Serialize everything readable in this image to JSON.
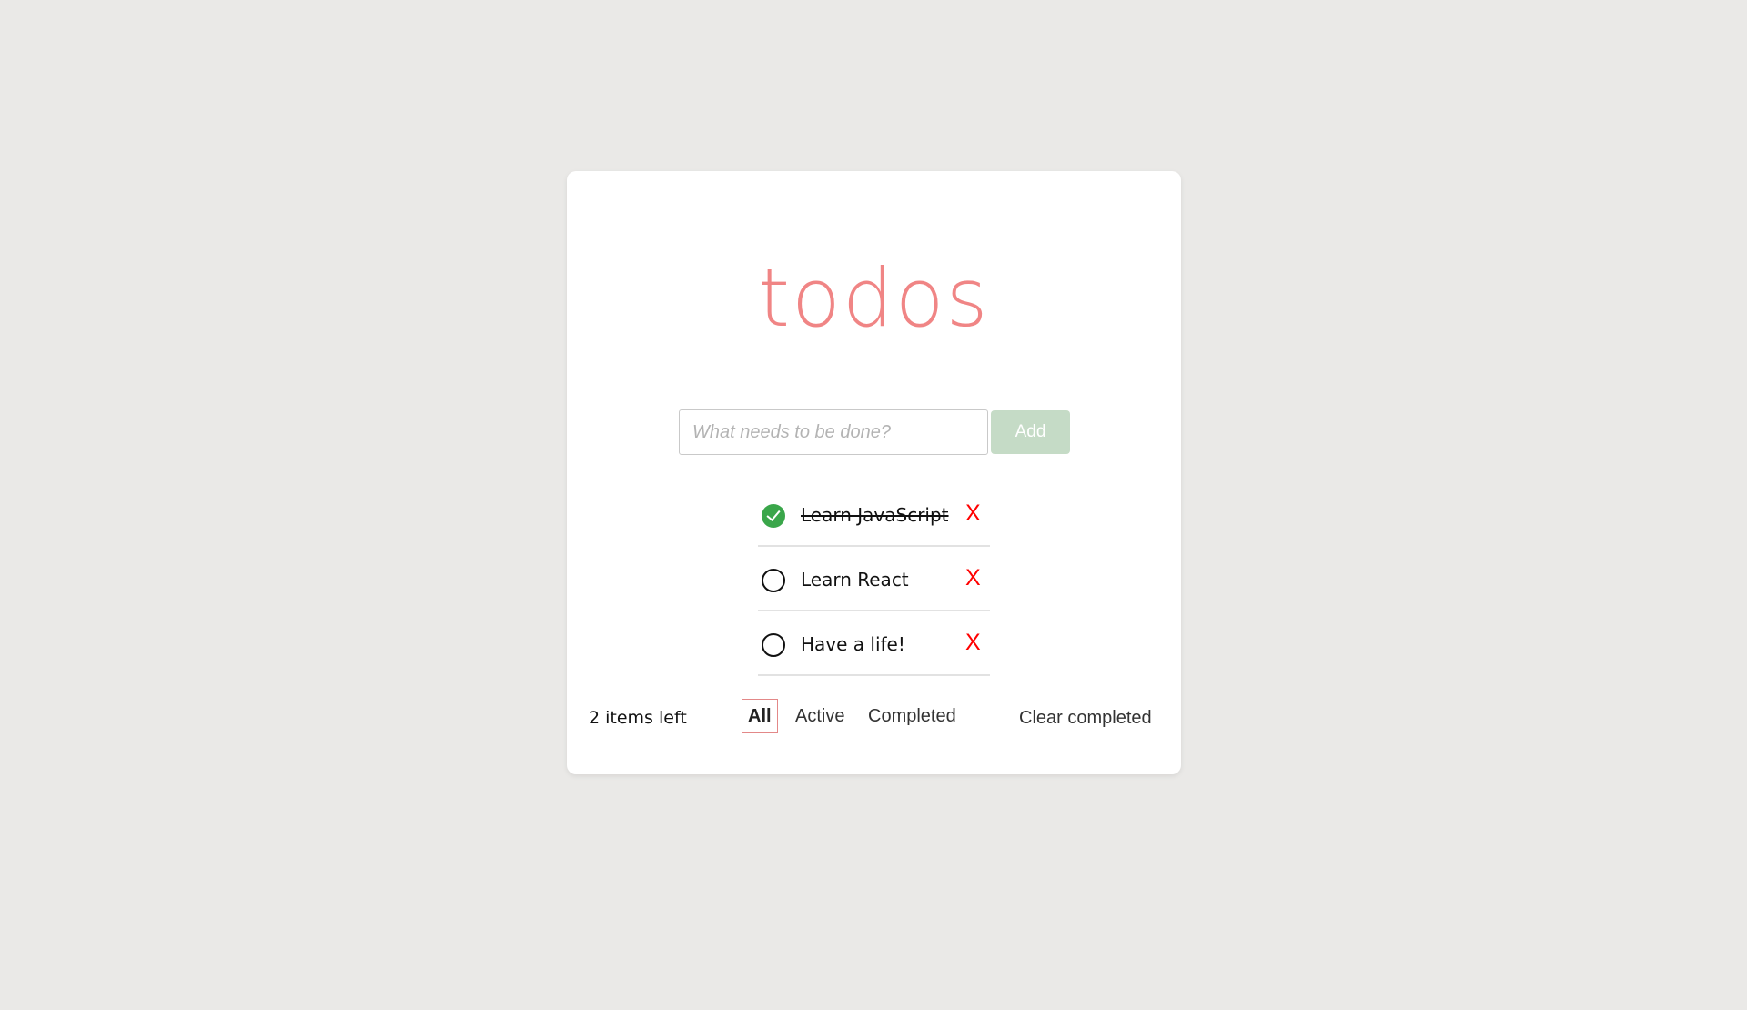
{
  "app": {
    "title": "todos"
  },
  "new_todo": {
    "placeholder": "What needs to be done?",
    "value": "",
    "add_label": "Add"
  },
  "todos": [
    {
      "text": "Learn JavaScript",
      "completed": true,
      "delete_label": "X"
    },
    {
      "text": "Learn React",
      "completed": false,
      "delete_label": "X"
    },
    {
      "text": "Have a life!",
      "completed": false,
      "delete_label": "X"
    }
  ],
  "footer": {
    "items_left": "2 items left",
    "filters": [
      {
        "label": "All",
        "selected": true
      },
      {
        "label": "Active",
        "selected": false
      },
      {
        "label": "Completed",
        "selected": false
      }
    ],
    "clear_completed": "Clear completed"
  },
  "colors": {
    "background": "#eae9e7",
    "title": "#f08585",
    "add_button": "#c5dbc6",
    "completed_check": "#3aa64a",
    "delete": "#ff0000",
    "selected_filter_border": "#e38888"
  }
}
